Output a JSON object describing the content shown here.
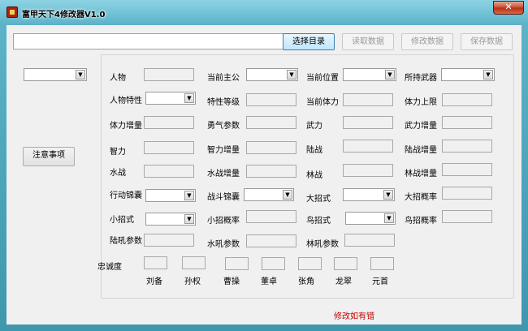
{
  "window": {
    "title": "富甲天下4修改器V1.0",
    "close_glyph": "✕"
  },
  "toolbar": {
    "path_value": "",
    "select_dir": "选择目录",
    "read_data": "读取数据",
    "modify_data": "修改数据",
    "save_data": "保存数据"
  },
  "left": {
    "combo_value": "",
    "notice_button": "注意事项"
  },
  "labels": {
    "person": "人物",
    "current_lord": "当前主公",
    "current_position": "当前位置",
    "held_weapon": "所持武器",
    "person_trait": "人物特性",
    "trait_level": "特性等级",
    "current_stamina": "当前体力",
    "stamina_limit": "体力上限",
    "stamina_growth": "体力增量",
    "courage_param": "勇气参数",
    "force": "武力",
    "force_growth": "武力增量",
    "intelligence": "智力",
    "intelligence_growth": "智力增量",
    "land_battle": "陆战",
    "land_battle_growth": "陆战增量",
    "water_battle": "水战",
    "water_battle_growth": "水战增量",
    "forest_battle": "林战",
    "forest_battle_growth": "林战增量",
    "action_kit": "行动锦囊",
    "battle_kit": "战斗锦囊",
    "big_skill": "大招式",
    "big_skill_rate": "大招概率",
    "small_skill": "小招式",
    "small_skill_rate": "小招概率",
    "bird_skill": "鸟招式",
    "bird_skill_rate": "鸟招概率",
    "land_roar_param": "陆吼参数",
    "water_roar_param": "水吼参数",
    "forest_roar_param": "林吼参数",
    "loyalty": "忠诚度"
  },
  "loyalty_names": [
    "刘备",
    "孙权",
    "曹操",
    "董卓",
    "张角",
    "龙翠",
    "元首"
  ],
  "footer": {
    "note": "修改如有错"
  },
  "colors": {
    "note_red": "#c00000",
    "accent_blue": "#3c7fb1",
    "close_red": "#c94a2e"
  }
}
